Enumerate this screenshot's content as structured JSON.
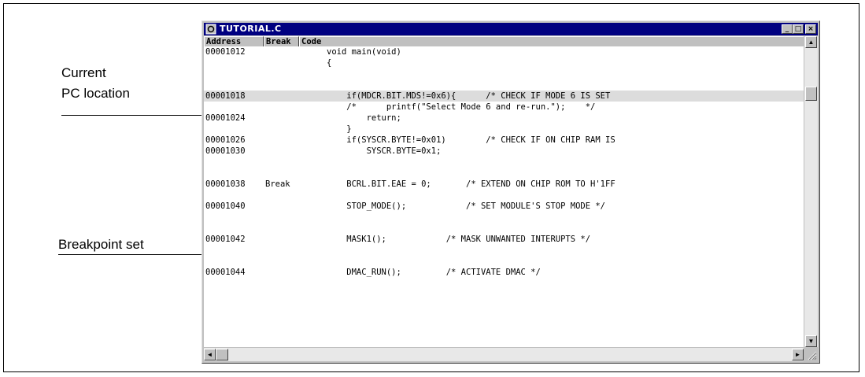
{
  "callouts": {
    "current_pc_line1": "Current",
    "current_pc_line2": "PC location",
    "breakpoint": "Breakpoint set"
  },
  "window": {
    "title": "TUTORIAL.C",
    "icon": "c-source-file-icon",
    "minimize_glyph": "_",
    "maximize_glyph": "□",
    "close_glyph": "×"
  },
  "columns": {
    "address": "Address",
    "break": "Break",
    "code": "Code"
  },
  "rows": [
    {
      "address": "00001012",
      "break": "",
      "code": "void main(void)",
      "indent": 0
    },
    {
      "address": "",
      "break": "",
      "code": "{",
      "indent": 0
    },
    {
      "address": "",
      "break": "",
      "code": "",
      "indent": 0
    },
    {
      "address": "00001018",
      "break": "",
      "code": "    if(MDCR.BIT.MDS!=0x6){      /* CHECK IF MODE 6 IS SET",
      "indent": 0,
      "current": true
    },
    {
      "address": "",
      "break": "",
      "code": "    /*      printf(\"Select Mode 6 and re-run.\");    */",
      "indent": 0
    },
    {
      "address": "00001024",
      "break": "",
      "code": "        return;",
      "indent": 0
    },
    {
      "address": "",
      "break": "",
      "code": "    }",
      "indent": 0
    },
    {
      "address": "00001026",
      "break": "",
      "code": "    if(SYSCR.BYTE!=0x01)        /* CHECK IF ON CHIP RAM IS",
      "indent": 0
    },
    {
      "address": "00001030",
      "break": "",
      "code": "        SYSCR.BYTE=0x1;",
      "indent": 0
    },
    {
      "address": "",
      "break": "",
      "code": "",
      "indent": 0
    },
    {
      "address": "00001038",
      "break": "Break",
      "code": "    BCRL.BIT.EAE = 0;       /* EXTEND ON CHIP ROM TO H'1FF",
      "indent": 0
    },
    {
      "address": "",
      "break": "",
      "code": "",
      "indent": 0
    },
    {
      "address": "00001040",
      "break": "",
      "code": "    STOP_MODE();            /* SET MODULE'S STOP MODE */",
      "indent": 0
    },
    {
      "address": "",
      "break": "",
      "code": "",
      "indent": 0
    },
    {
      "address": "00001042",
      "break": "",
      "code": "    MASK1();            /* MASK UNWANTED INTERUPTS */",
      "indent": 0
    },
    {
      "address": "",
      "break": "",
      "code": "",
      "indent": 0
    },
    {
      "address": "00001044",
      "break": "",
      "code": "    DMAC_RUN();         /* ACTIVATE DMAC */",
      "indent": 0
    }
  ],
  "scrollbar": {
    "up_glyph": "▲",
    "down_glyph": "▼",
    "left_glyph": "◄",
    "right_glyph": "►"
  },
  "colors": {
    "title_bar": "#000080",
    "window_face": "#c0c0c0",
    "current_line": "#dcdcdc"
  }
}
